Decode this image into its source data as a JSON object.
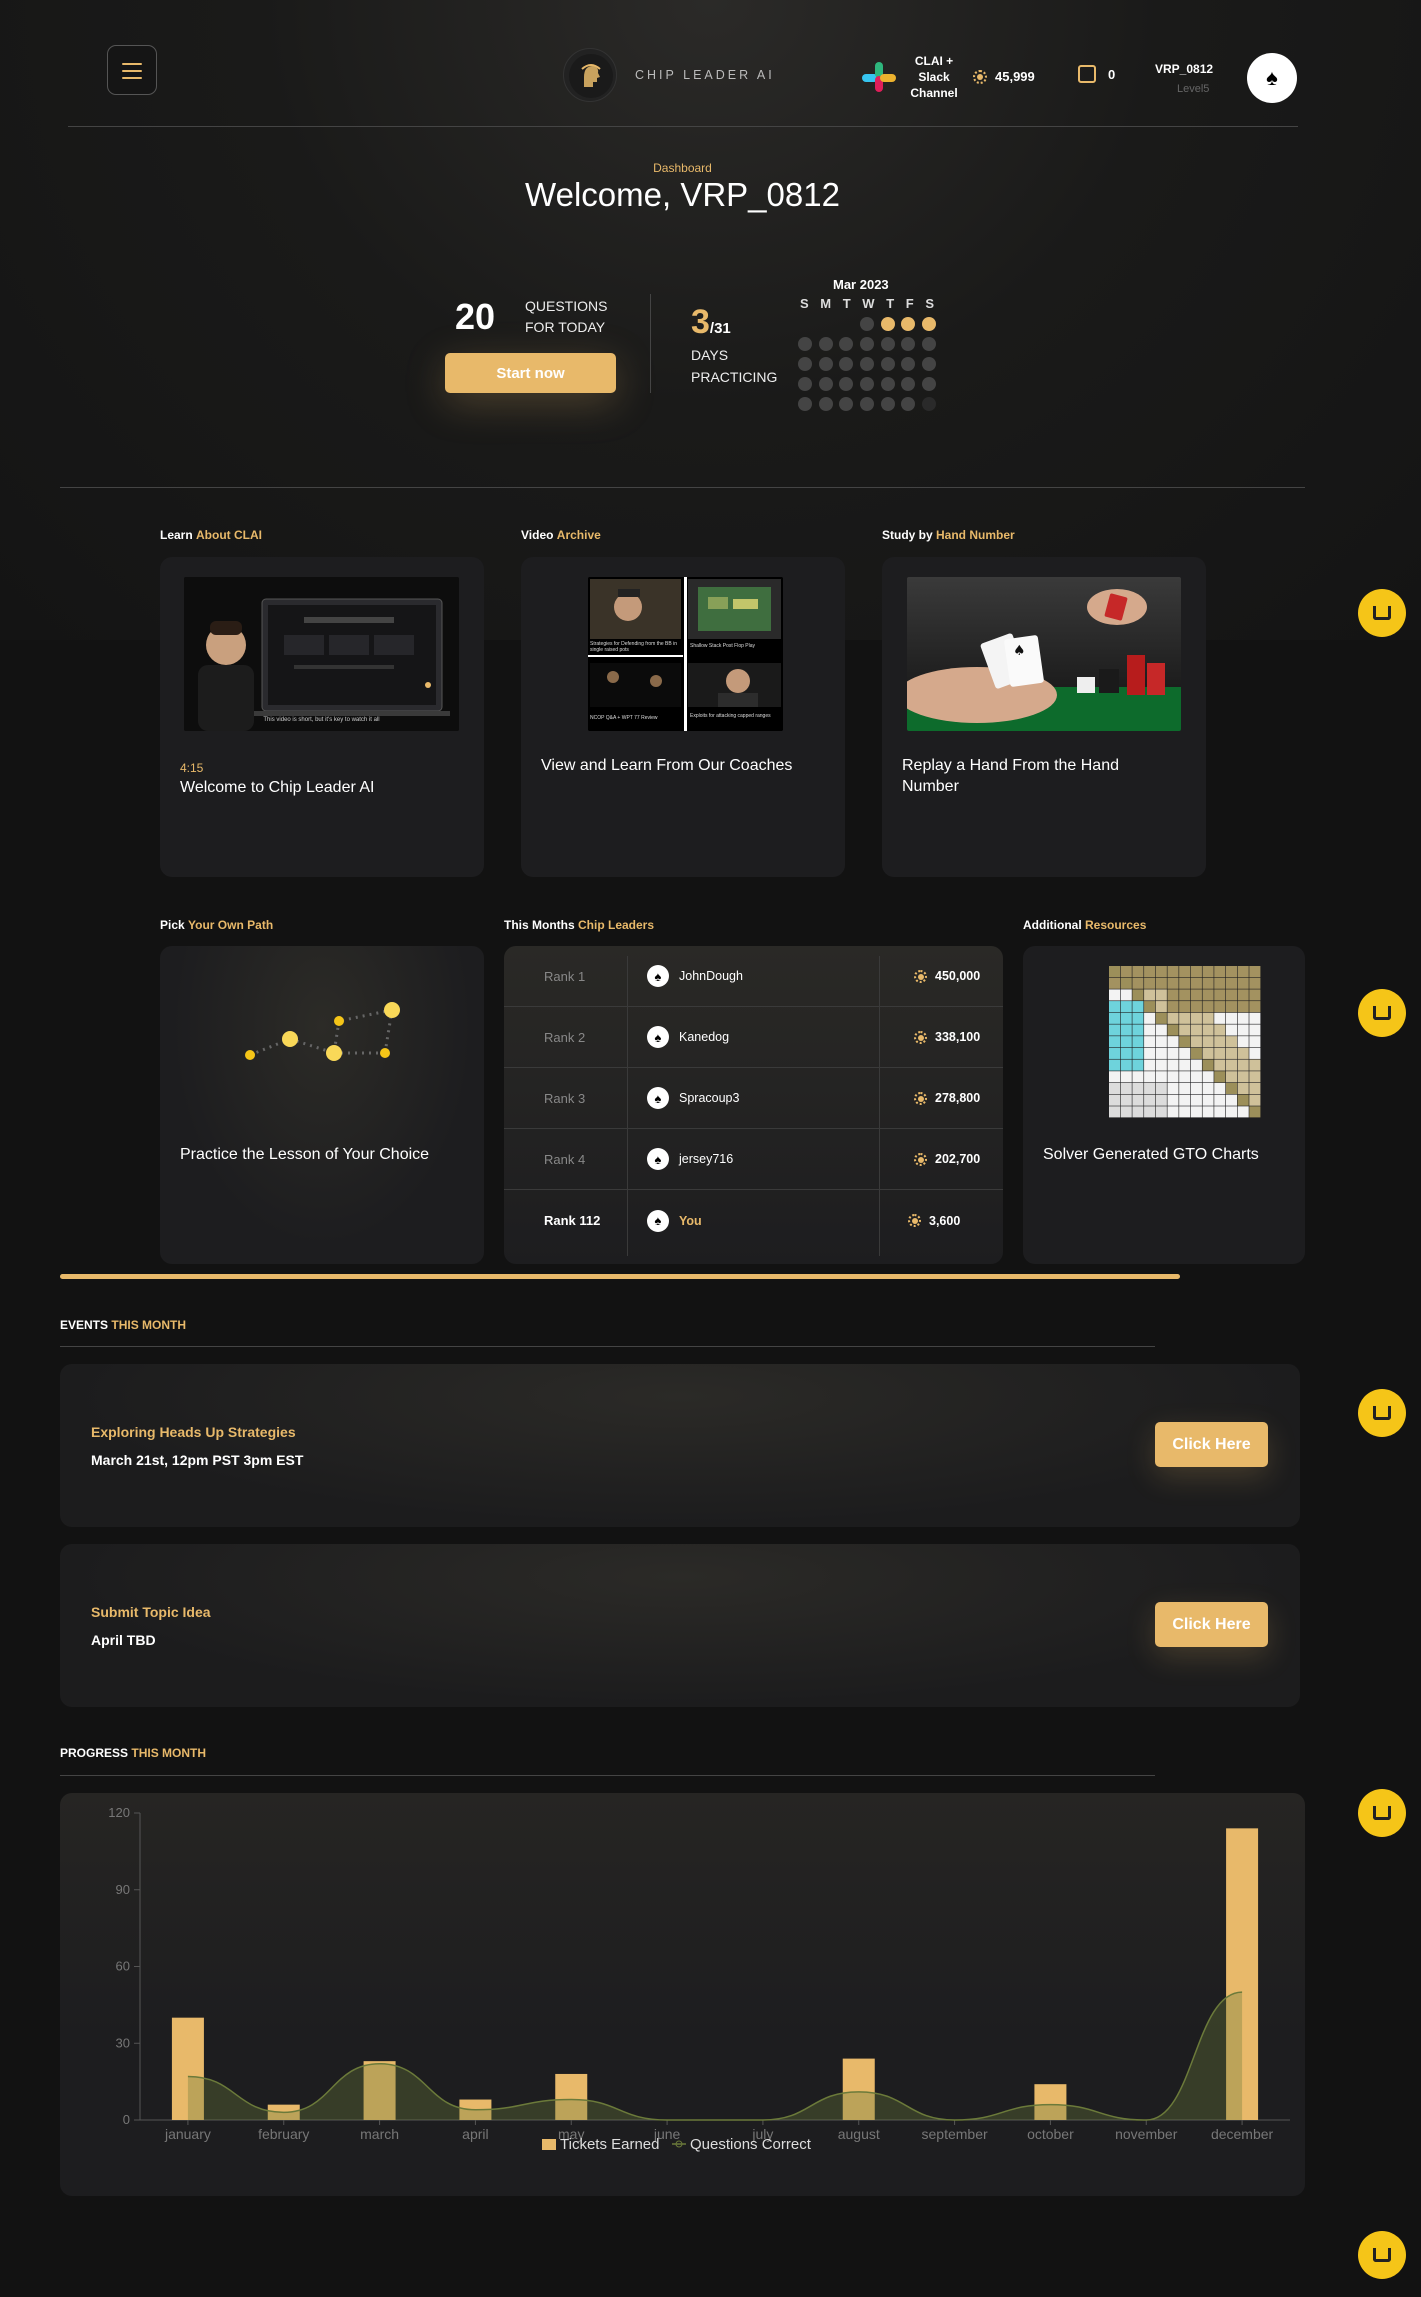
{
  "header": {
    "brand": "CHIP LEADER AI",
    "slack_label": "CLAI + Slack Channel",
    "balance": "45,999",
    "tickets": "0",
    "username": "VRP_0812",
    "level": "Level5"
  },
  "hero": {
    "breadcrumb": "Dashboard",
    "welcome": "Welcome, VRP_0812",
    "questions_count": "20",
    "questions_label_1": "QUESTIONS",
    "questions_label_2": "FOR TODAY",
    "start_label": "Start now",
    "days_num": "3",
    "days_total": "/31",
    "days_label_1": "DAYS",
    "days_label_2": "PRACTICING",
    "calendar": {
      "month": "Mar 2023",
      "weekdays": [
        "S",
        "M",
        "T",
        "W",
        "T",
        "F",
        "S"
      ],
      "practiced_days": 3
    }
  },
  "learn_cards": [
    {
      "section_pre": "Learn ",
      "section_hl": "About CLAI",
      "time": "4:15",
      "title": "Welcome to Chip Leader AI",
      "caption": "This video is short, but it's key to watch it all"
    },
    {
      "section_pre": "Video ",
      "section_hl": "Archive",
      "title": "View and Learn From Our Coaches",
      "captions": [
        "Strategies for Defending from the BB in single raised pots",
        "Shallow Stack Post Flop Play",
        "NCOP Q&A + WPT 77 Review",
        "Exploits for attacking capped ranges"
      ]
    },
    {
      "section_pre": "Study by ",
      "section_hl": "Hand Number",
      "title": "Replay a Hand From the Hand Number"
    }
  ],
  "path_card": {
    "section_pre": "Pick ",
    "section_hl": "Your Own Path",
    "title": "Practice the Lesson of Your Choice"
  },
  "leaderboard": {
    "section_pre": "This Months ",
    "section_hl": "Chip Leaders",
    "rows": [
      {
        "rank": "Rank 1",
        "name": "JohnDough",
        "score": "450,000"
      },
      {
        "rank": "Rank 2",
        "name": "Kanedog",
        "score": "338,100"
      },
      {
        "rank": "Rank 3",
        "name": "Spracoup3",
        "score": "278,800"
      },
      {
        "rank": "Rank 4",
        "name": "jersey716",
        "score": "202,700"
      },
      {
        "rank": "Rank 112",
        "name": "You",
        "score": "3,600"
      }
    ]
  },
  "resources_card": {
    "section_pre": "Additional ",
    "section_hl": "Resources",
    "title": "Solver Generated GTO Charts"
  },
  "events": {
    "label_pre": "EVENTS ",
    "label_hl": "THIS MONTH",
    "items": [
      {
        "title": "Exploring Heads Up Strategies",
        "date": "March 21st, 12pm PST 3pm EST",
        "button": "Click Here"
      },
      {
        "title": "Submit Topic Idea",
        "date": "April TBD",
        "button": "Click Here"
      }
    ]
  },
  "progress": {
    "label_pre": "PROGRESS ",
    "label_hl": "THIS MONTH"
  },
  "colors": {
    "accent": "#e8b96a",
    "background": "#121212",
    "card": "#1d1d1f",
    "line_series": "#6b7a3a",
    "side_icon": "#f5c518"
  },
  "chart_data": {
    "type": "bar",
    "categories": [
      "january",
      "february",
      "march",
      "april",
      "may",
      "june",
      "july",
      "august",
      "september",
      "october",
      "november",
      "december"
    ],
    "series": [
      {
        "name": "Tickets Earned",
        "kind": "bar",
        "values": [
          40,
          6,
          23,
          8,
          18,
          0,
          0,
          24,
          0,
          14,
          0,
          114
        ]
      },
      {
        "name": "Questions Correct",
        "kind": "area",
        "values": [
          17,
          3,
          22,
          4,
          8,
          0,
          0,
          11,
          0,
          6,
          0,
          50
        ]
      }
    ],
    "ylim": [
      0,
      120
    ],
    "yticks": [
      0,
      30,
      60,
      90,
      120
    ],
    "legend": "bottom-center"
  }
}
